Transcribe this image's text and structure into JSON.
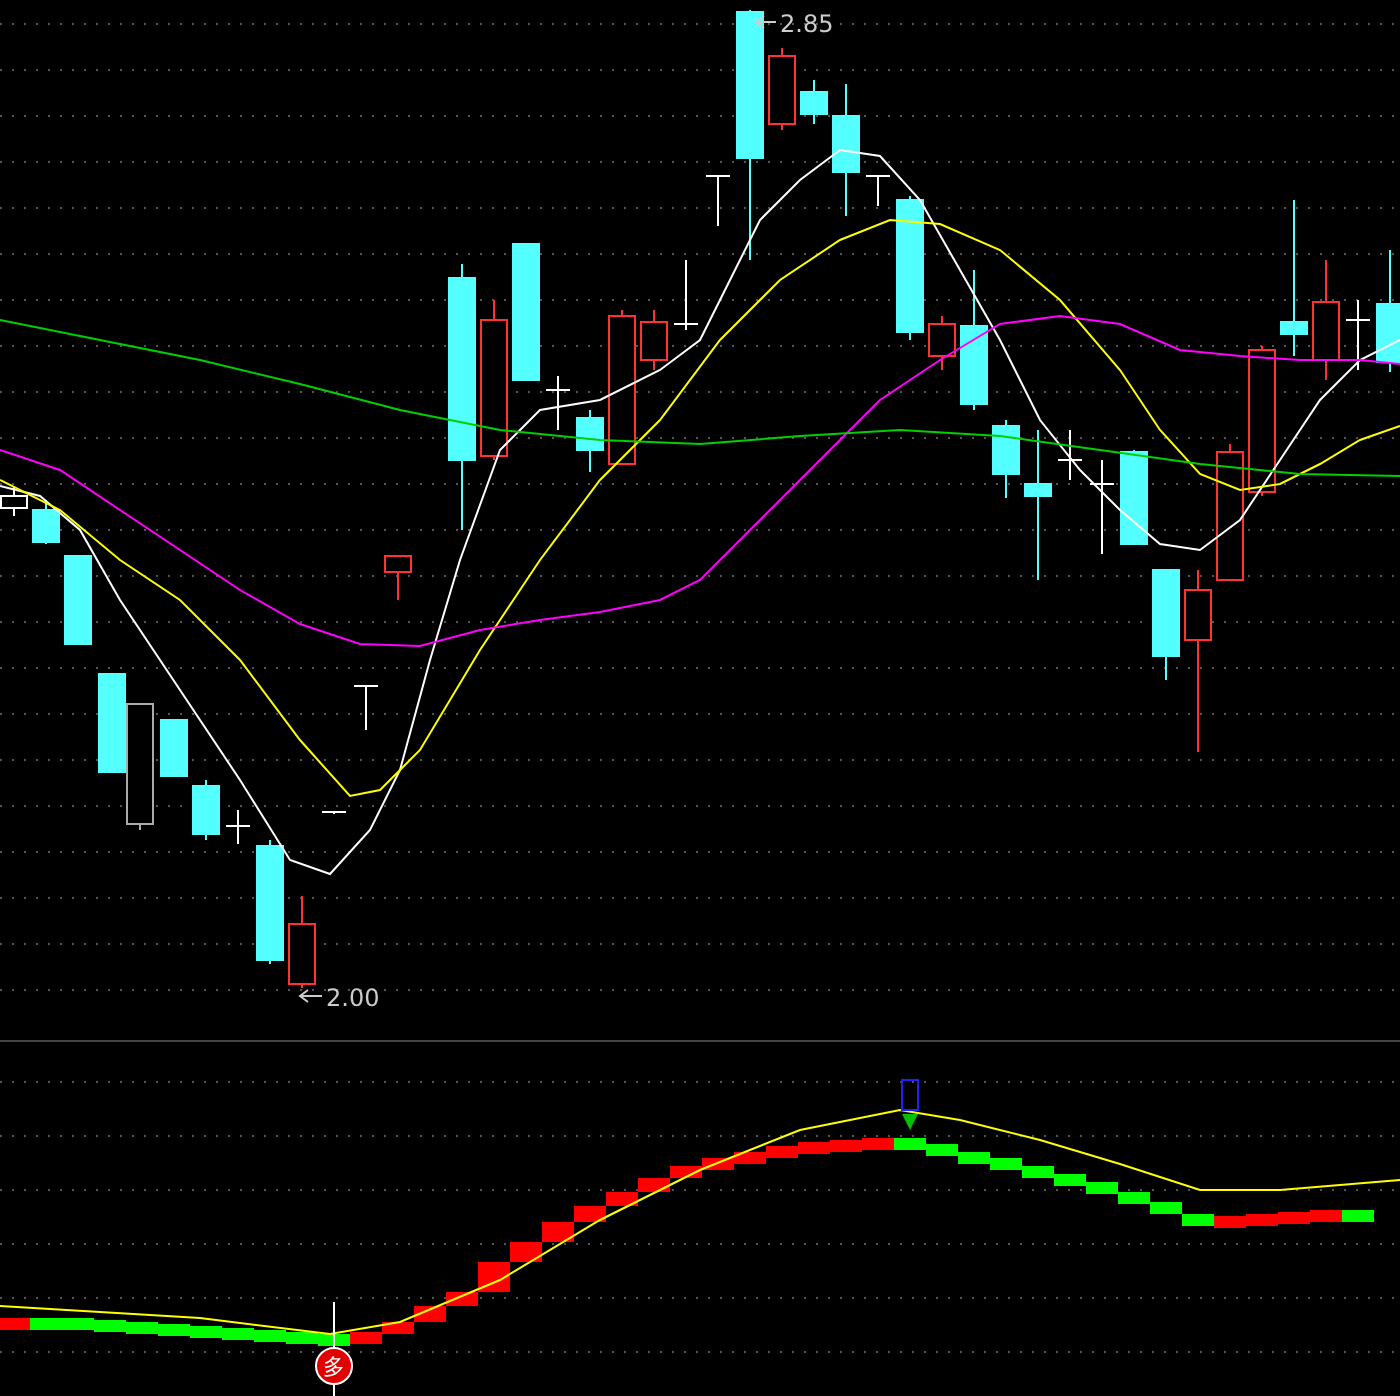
{
  "price_chart": {
    "high_label": "2.85",
    "low_label": "2.00"
  },
  "indicator_panel": {
    "signal_marker": "多"
  }
}
